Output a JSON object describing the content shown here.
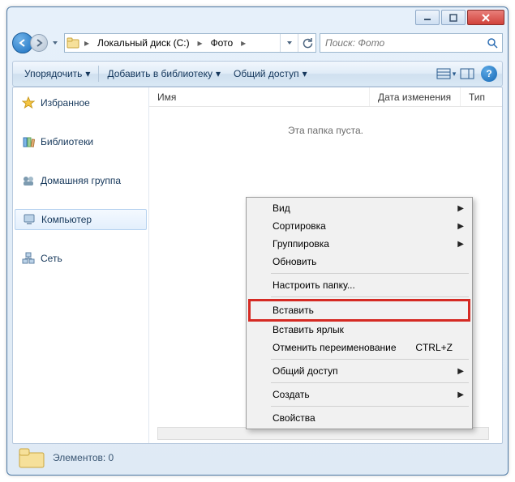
{
  "breadcrumb": {
    "seg1": "Локальный диск (C:)",
    "seg2": "Фото"
  },
  "search": {
    "placeholder": "Поиск: Фото"
  },
  "toolbar": {
    "organize": "Упорядочить",
    "addlib": "Добавить в библиотеку",
    "share": "Общий доступ"
  },
  "columns": {
    "name": "Имя",
    "date": "Дата изменения",
    "type": "Тип"
  },
  "empty": "Эта папка пуста.",
  "sidebar": {
    "favorites": "Избранное",
    "libraries": "Библиотеки",
    "homegroup": "Домашняя группа",
    "computer": "Компьютер",
    "network": "Сеть"
  },
  "context": {
    "view": "Вид",
    "sort": "Сортировка",
    "group": "Группировка",
    "refresh": "Обновить",
    "customize": "Настроить папку...",
    "paste": "Вставить",
    "paste_shortcut": "Вставить ярлык",
    "undo_rename": "Отменить переименование",
    "undo_key": "CTRL+Z",
    "share": "Общий доступ",
    "create": "Создать",
    "properties": "Свойства"
  },
  "status": {
    "text": "Элементов: 0"
  }
}
